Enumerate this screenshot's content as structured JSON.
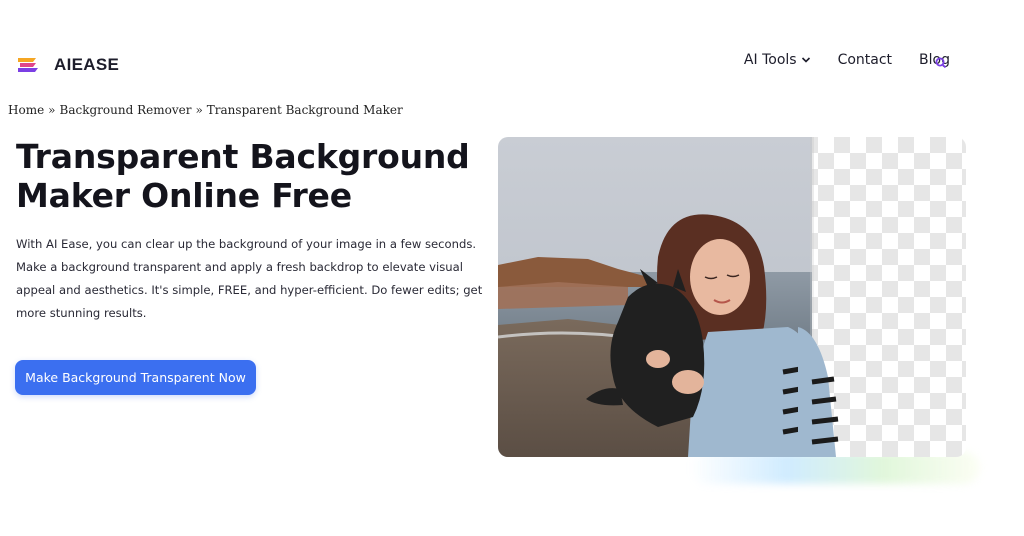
{
  "header": {
    "logo_text": "AIEASE",
    "nav": {
      "ai_tools": "AI Tools",
      "contact": "Contact",
      "blog": "Blog"
    }
  },
  "breadcrumb": {
    "home": "Home",
    "sep1": "»",
    "background_remover": "Background Remover",
    "sep2": "»",
    "current": "Transparent Background Maker"
  },
  "hero": {
    "title_line1": "Transparent Background",
    "title_line2": "Maker Online Free",
    "description": "With AI Ease, you can clear up the background of your image in a few seconds. Make a background transparent and apply a fresh backdrop to elevate visual appeal and aesthetics. It's simple, FREE, and hyper-efficient. Do fewer edits; get more stunning results.",
    "cta_label": "Make Background Transparent Now"
  },
  "colors": {
    "accent": "#3b6ff0",
    "logo_orange": "#f5a623",
    "logo_purple": "#7b3fe4",
    "search_purple": "#7b3fe4"
  },
  "icons": {
    "chevron": "chevron-down-icon",
    "search": "search-icon"
  }
}
